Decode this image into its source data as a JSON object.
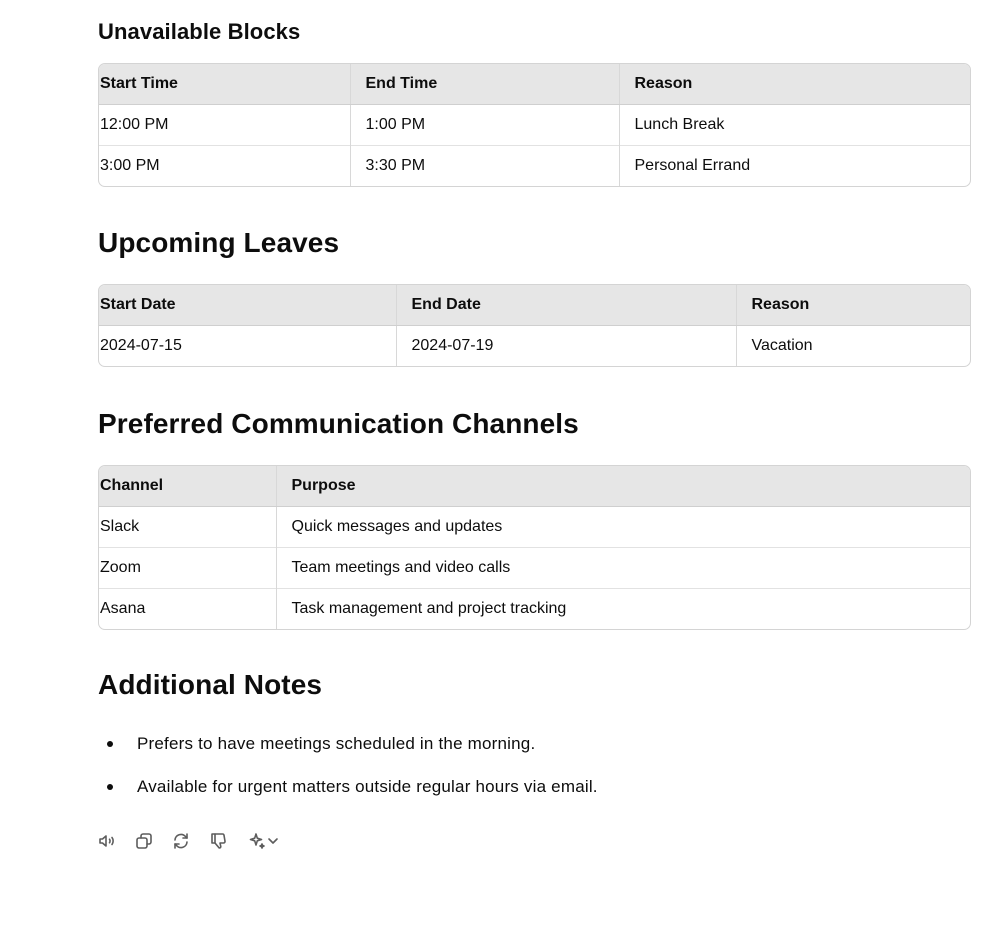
{
  "unavailable_blocks": {
    "title": "Unavailable Blocks",
    "headers": [
      "Start Time",
      "End Time",
      "Reason"
    ],
    "rows": [
      [
        "12:00 PM",
        "1:00 PM",
        "Lunch Break"
      ],
      [
        "3:00 PM",
        "3:30 PM",
        "Personal Errand"
      ]
    ]
  },
  "upcoming_leaves": {
    "title": "Upcoming Leaves",
    "headers": [
      "Start Date",
      "End Date",
      "Reason"
    ],
    "rows": [
      [
        "2024-07-15",
        "2024-07-19",
        "Vacation"
      ]
    ]
  },
  "channels": {
    "title": "Preferred Communication Channels",
    "headers": [
      "Channel",
      "Purpose"
    ],
    "rows": [
      [
        "Slack",
        "Quick messages and updates"
      ],
      [
        "Zoom",
        "Team meetings and video calls"
      ],
      [
        "Asana",
        "Task management and project tracking"
      ]
    ]
  },
  "notes": {
    "title": "Additional Notes",
    "items": [
      "Prefers to have meetings scheduled in the morning.",
      "Available for urgent matters outside regular hours via email."
    ]
  },
  "action_bar": {
    "icons": [
      "read-aloud-icon",
      "copy-icon",
      "regenerate-icon",
      "thumbs-down-icon",
      "sparkle-icon",
      "chevron-down-icon"
    ]
  }
}
